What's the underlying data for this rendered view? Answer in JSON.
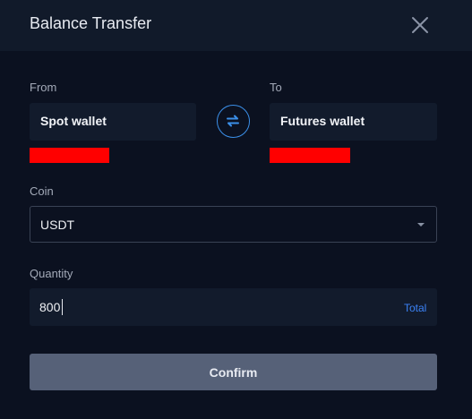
{
  "dialog": {
    "title": "Balance Transfer"
  },
  "from": {
    "label": "From",
    "wallet": "Spot wallet"
  },
  "to": {
    "label": "To",
    "wallet": "Futures wallet"
  },
  "coin": {
    "label": "Coin",
    "selected": "USDT"
  },
  "quantity": {
    "label": "Quantity",
    "value": "800",
    "total_label": "Total"
  },
  "confirm_label": "Confirm",
  "icons": [
    "close-icon",
    "swap-icon",
    "chevron-down-icon"
  ],
  "colors": {
    "background": "#0b1120",
    "header": "#111a2a",
    "field": "#121b2c",
    "accent": "#3b82f6",
    "swap_ring": "#3b8fe8",
    "button": "#566178",
    "redaction": "#ff0000"
  }
}
